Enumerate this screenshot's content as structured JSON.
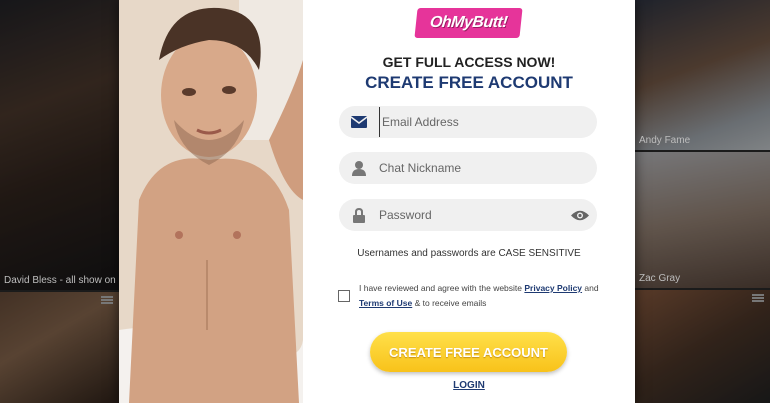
{
  "background": {
    "captions": {
      "left_tile": "David Bless - all show on ha",
      "right_top": "Andy Fame",
      "right_mid": "Zac Gray"
    }
  },
  "modal": {
    "logo": "OhMyButt!",
    "headline": "GET FULL ACCESS NOW!",
    "subhead": "CREATE FREE ACCOUNT",
    "email": {
      "placeholder": "Email Address",
      "icon": "envelope-icon"
    },
    "nickname": {
      "placeholder": "Chat Nickname",
      "icon": "user-icon"
    },
    "password": {
      "placeholder": "Password",
      "icon": "lock-icon",
      "toggle_icon": "eye-icon"
    },
    "note": "Usernames and passwords are CASE SENSITIVE",
    "agree": {
      "text_before": "I have reviewed and agree with the website ",
      "privacy_link": "Privacy Policy",
      "text_mid": " and ",
      "terms_link": "Terms of Use",
      "text_after": " & to receive emails"
    },
    "cta": "CREATE FREE ACCOUNT",
    "login": "LOGIN"
  },
  "colors": {
    "brand_pink": "#e6349a",
    "navy": "#1e3a72",
    "cta_yellow": "#f8c21a"
  }
}
